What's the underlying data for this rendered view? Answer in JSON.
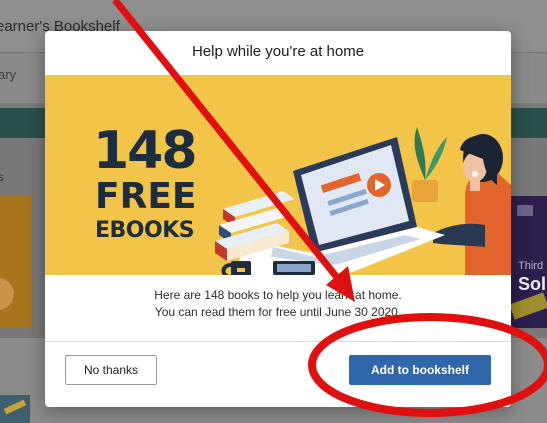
{
  "background": {
    "app_title": "earner's Bookshelf",
    "nav_label": "ary",
    "shelf_label": "s",
    "book_right_line1": "Third",
    "book_right_line2": "Sol"
  },
  "modal": {
    "title": "Help while you're at home",
    "banner": {
      "number": "148",
      "line2": "FREE",
      "line3": "EBOOKS"
    },
    "message_line1": "Here are 148 books to help you learn at home.",
    "message_line2": "You can read them for free until June 30 2020.",
    "no_thanks_label": "No thanks",
    "add_label": "Add to bookshelf"
  },
  "colors": {
    "banner_bg": "#f2c447",
    "primary_button": "#2f67aa",
    "annotation_red": "#e01010"
  },
  "icons": [
    "laptop-illustration",
    "play-icon",
    "plant-icon",
    "books-stack-icon",
    "mug-icon",
    "phone-icon"
  ]
}
